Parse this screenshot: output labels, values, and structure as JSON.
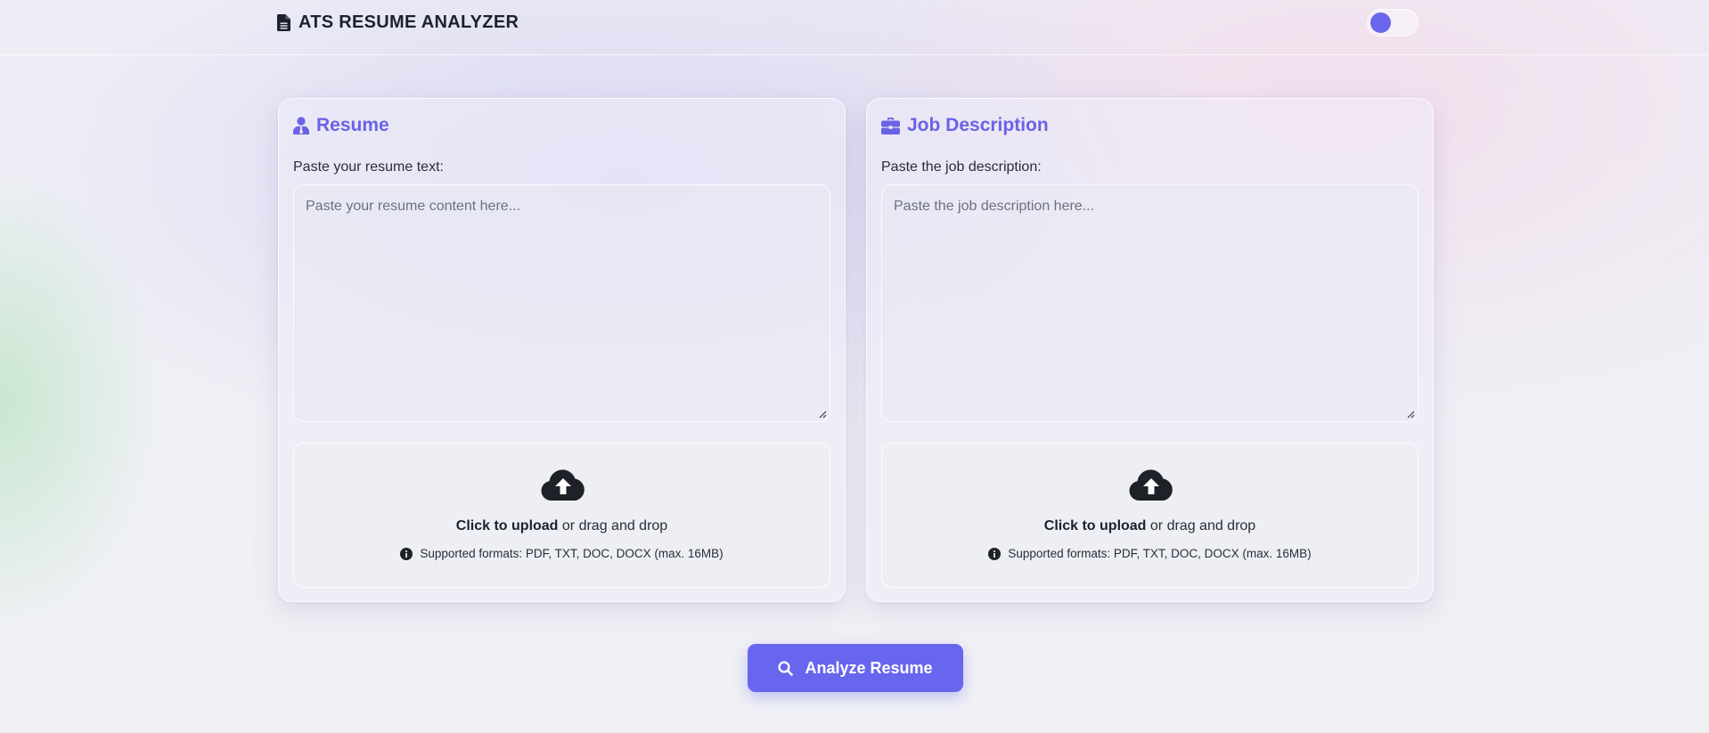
{
  "header": {
    "title": "ATS RESUME ANALYZER",
    "brand_icon": "file-lines-icon",
    "theme_toggle": {
      "state": "off",
      "knob_color": "#6b66ee"
    }
  },
  "resume_panel": {
    "title": "Resume",
    "icon": "user-tie-icon",
    "field_label": "Paste your resume text:",
    "textarea": {
      "value": "",
      "placeholder": "Paste your resume content here..."
    },
    "upload": {
      "icon": "cloud-upload-icon",
      "cta_bold": "Click to upload",
      "cta_rest": " or drag and drop",
      "formats": "Supported formats: PDF, TXT, DOC, DOCX (max. 16MB)"
    }
  },
  "job_panel": {
    "title": "Job Description",
    "icon": "briefcase-icon",
    "field_label": "Paste the job description:",
    "textarea": {
      "value": "",
      "placeholder": "Paste the job description here..."
    },
    "upload": {
      "icon": "cloud-upload-icon",
      "cta_bold": "Click to upload",
      "cta_rest": " or drag and drop",
      "formats": "Supported formats: PDF, TXT, DOC, DOCX (max. 16MB)"
    }
  },
  "actions": {
    "analyze_label": "Analyze Resume",
    "analyze_icon": "search-icon"
  },
  "colors": {
    "accent": "#6865ef",
    "title_accent": "#6a63e6",
    "text_dark": "#1d2030"
  }
}
